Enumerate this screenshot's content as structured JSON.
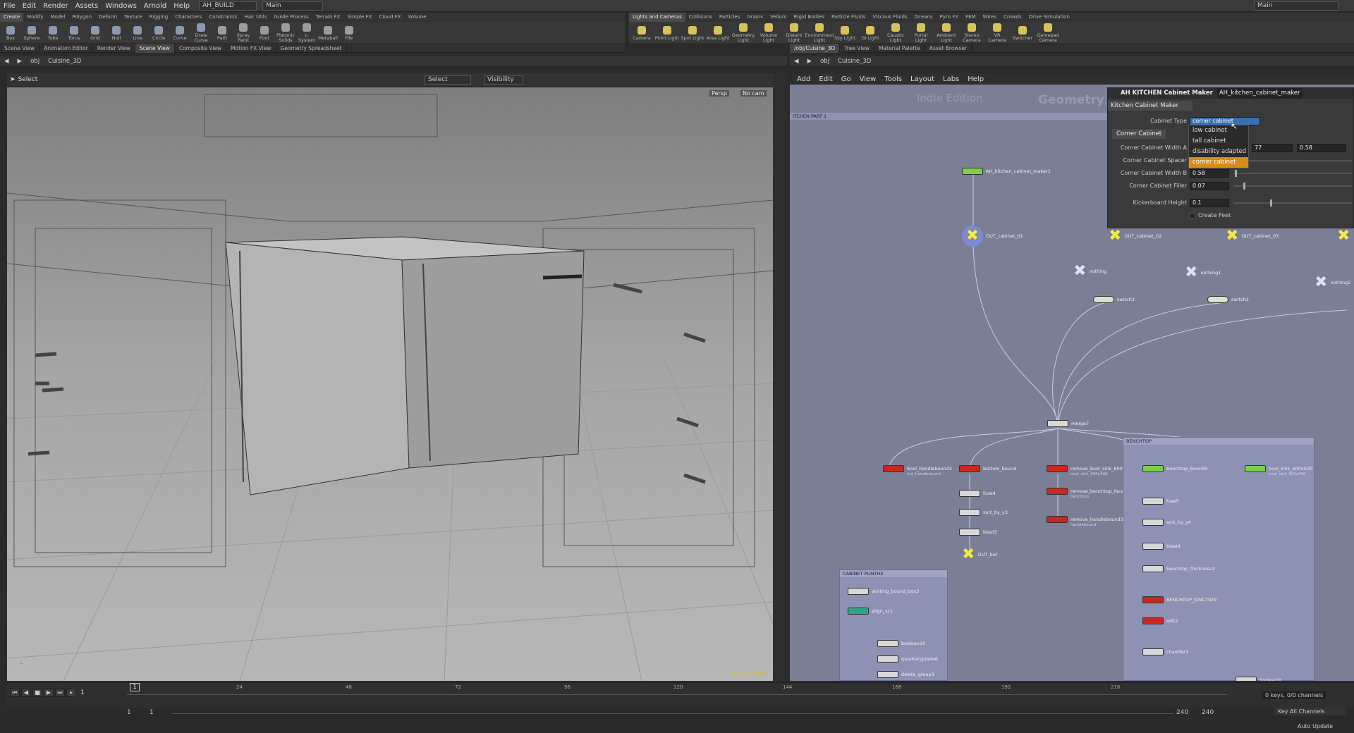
{
  "menubar": {
    "items": [
      "File",
      "Edit",
      "Render",
      "Assets",
      "Windows",
      "Arnold",
      "Help"
    ],
    "desktop": "AH_BUILD",
    "context": "Main",
    "right_context": "Main"
  },
  "shelf_left": {
    "tabs": [
      "Create",
      "Modify",
      "Model",
      "Polygon",
      "Deform",
      "Texture",
      "Rigging",
      "Characters",
      "Constraints",
      "Hair Utils",
      "Guide Process",
      "Terrain FX",
      "Simple FX",
      "Cloud FX",
      "Volume"
    ],
    "tools": [
      "Box",
      "Sphere",
      "Tube",
      "Torus",
      "Grid",
      "Null",
      "Line",
      "Circle",
      "Curve",
      "Draw Curve",
      "Path",
      "Spray Paint",
      "Font",
      "Platonic Solids",
      "L-System",
      "Metaball",
      "File"
    ]
  },
  "shelf_right": {
    "tabs": [
      "Lights and Cameras",
      "Collisions",
      "Particles",
      "Grains",
      "Vellum",
      "Rigid Bodies",
      "Particle Fluids",
      "Viscous Fluids",
      "Oceans",
      "Pyro FX",
      "FEM",
      "Wires",
      "Crowds",
      "Drive Simulation"
    ],
    "tools": [
      "Camera",
      "Point Light",
      "Spot Light",
      "Area Light",
      "Geometry Light",
      "Volume Light",
      "Distant Light",
      "Environment Light",
      "Sky Light",
      "GI Light",
      "Caustic Light",
      "Portal Light",
      "Ambient Light",
      "Stereo Camera",
      "VR Camera",
      "Switcher",
      "Gamepad Camera"
    ]
  },
  "left_panel": {
    "tabs": [
      "Scene View",
      "Animation Editor",
      "Render View",
      "Scene View",
      "Composite View",
      "Motion FX View",
      "Geometry Spreadsheet"
    ],
    "active_tab": 3,
    "path": [
      "obj",
      "Cuisine_3D"
    ],
    "toolbar": {
      "select": "Select",
      "mode": "Select",
      "visibility": "Visibility"
    },
    "persp": "Persp",
    "cam": "No cam",
    "edition": "Indie Edition"
  },
  "right_panel": {
    "tabs": [
      "/obj/Cuisine_3D",
      "Tree View",
      "Material Palette",
      "Asset Browser"
    ],
    "path": [
      "obj",
      "Cuisine_3D"
    ],
    "menu": [
      "Add",
      "Edit",
      "Go",
      "View",
      "Tools",
      "Layout",
      "Labs",
      "Help"
    ],
    "watermark": "Indie Edition",
    "context_label": "Geometry",
    "netbox_label": "ITCHEN PART 1"
  },
  "params": {
    "header_type": "AH KITCHEN Cabinet Maker",
    "header_name": "AH_kitchen_cabinet_maker",
    "section": "Kitchen Cabinet Maker",
    "cabinet_type_label": "Cabinet Type",
    "cabinet_type_value": "corner cabinet",
    "subsection": "Corner Cabinet",
    "width_a_label": "Corner Cabinet Width A",
    "width_a_value": "77",
    "width_a_value2": "0.58",
    "spacer_label": "Corner Cabinet Spacer",
    "width_b_label": "Corner Cabinet Width B",
    "width_b_value": "0.58",
    "filler_label": "Corner Cabinet Filler",
    "filler_value": "0.07",
    "kick_label": "Kickerboard Height",
    "kick_value": "0.1",
    "feet_label": "Create Feet",
    "options": [
      "low cabinet",
      "tall cabinet",
      "disability adapted",
      "corner cabinet"
    ]
  },
  "nodes": {
    "maker": "AH_kitchen_cabinet_maker1",
    "out1": "OUT_cabinet_01",
    "out2": "OUT_cabinet_02",
    "out3": "OUT_cabinet_03",
    "nothing": "nothing",
    "nothing1": "nothing1",
    "nothing2": "nothing2",
    "switch3": "switch3",
    "switch2": "switch2",
    "merge7": "merge7",
    "bool_hb": "bool_handlebound3",
    "bool_hb_sub": "not_handlebound",
    "bottom_bound": "bottom_bound",
    "remove_bool": "remove_bool_sink_600x500",
    "remove_bool_sub": "bool_sink_600x500",
    "remove_bench": "remove_benchtop_faces3",
    "remove_bench_sub": "benchtop",
    "remove_hb": "remove_handlebound3",
    "remove_hb_sub": "handlebound",
    "fuse4": "fuse4",
    "sort_by_y3": "sort_by_y3",
    "blast5": "blast5",
    "out_bot": "OUT_bot",
    "benchtop_box": "BENCHTOP",
    "benchtop_bound3": "benchtop_bound3",
    "bool_sink": "bool_sink_600x500",
    "bool_sink_sub": "bool_sink_600x500",
    "fuse5": "fuse5",
    "sort_by_y4": "sort_by_y4",
    "blast4": "blast4",
    "benchtop_thickness": "benchtop_thickness3",
    "benchtop_junction": "BENCHTOP_JUNCTION",
    "edit2": "edit2",
    "chamfer3": "chamfer3",
    "boolean9": "boolean9",
    "plinth_box": "CABINET PLINTHE",
    "skirting_bound": "skirting_bound_box3",
    "align_sz": "align_sz1",
    "boolean10": "boolean10",
    "quadrangulate": "quadrangulate6",
    "delete_group": "delete_group3"
  },
  "timeline": {
    "frame": "1",
    "ticks": [
      "24",
      "48",
      "72",
      "96",
      "120",
      "144",
      "168",
      "192",
      "216"
    ],
    "start": "1",
    "start2": "1",
    "end": "240",
    "end2": "240",
    "keys": "0 keys, 0/0 channels",
    "key_all": "Key All Channels",
    "auto_update": "Auto Update"
  }
}
